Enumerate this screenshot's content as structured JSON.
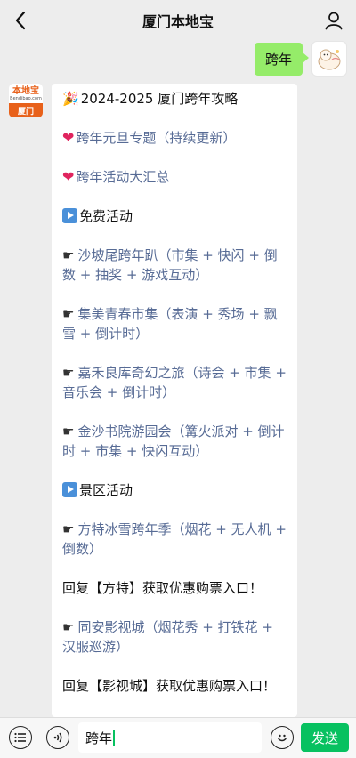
{
  "header": {
    "title": "厦门本地宝",
    "back_icon": "chevron-left-icon",
    "profile_icon": "user-icon"
  },
  "user_message": {
    "text": "跨年",
    "bubble_color": "#95ec69"
  },
  "bot_avatar": {
    "logo": "本地宝",
    "site": "Bendibao.com",
    "city": "厦门",
    "brand_color": "#e8611a"
  },
  "bot_message": {
    "title": "2024-2025 厦门跨年攻略",
    "items": [
      {
        "icon": "heart-icon",
        "text": "跨年元旦专题（持续更新）"
      },
      {
        "icon": "heart-icon",
        "text": "跨年活动大汇总"
      },
      {
        "icon": "play-icon",
        "text": "免费活动"
      },
      {
        "icon": "hand-pointing-icon",
        "text": "沙坡尾跨年趴（市集 + 快闪 + 倒数 + 抽奖 + 游戏互动）"
      },
      {
        "icon": "hand-pointing-icon",
        "text": "集美青春市集（表演 + 秀场 + 飘雪 + 倒计时）"
      },
      {
        "icon": "hand-pointing-icon",
        "text": "嘉禾良库奇幻之旅（诗会 + 市集 + 音乐会 + 倒计时）"
      },
      {
        "icon": "hand-pointing-icon",
        "text": "金沙书院游园会（篝火派对 + 倒计时 + 市集 + 快闪互动）"
      },
      {
        "icon": "play-icon",
        "text": "景区活动"
      },
      {
        "icon": "hand-pointing-icon",
        "text": "方特冰雪跨年季（烟花 + 无人机 + 倒数）"
      },
      {
        "icon": "",
        "text": "回复【方特】获取优惠购票入口！"
      },
      {
        "icon": "hand-pointing-icon",
        "text": "同安影视城（烟花秀 + 打铁花 + 汉服巡游）"
      },
      {
        "icon": "",
        "text": "回复【影视城】获取优惠购票入口！"
      }
    ],
    "link_color": "#576b95"
  },
  "input_bar": {
    "input_value": "跨年",
    "send_label": "发送",
    "send_color": "#07c160"
  }
}
